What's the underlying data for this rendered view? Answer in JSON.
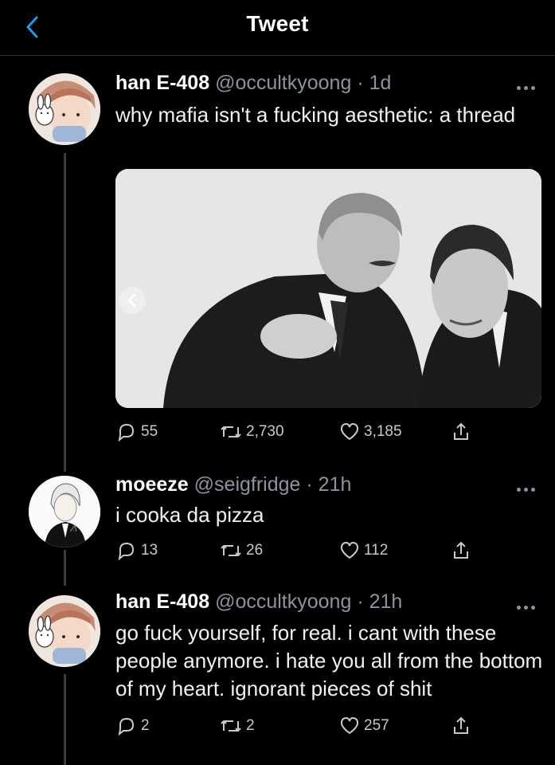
{
  "header": {
    "title": "Tweet",
    "back_icon": "chevron-left-icon",
    "accent": "#1d9bf0"
  },
  "tweets": [
    {
      "name": "han E-408",
      "handle": "@occultkyoong",
      "time": "· 1d",
      "text": "why mafia isn't a fucking aesthetic: a thread",
      "replies": "55",
      "retweets": "2,730",
      "likes": "3,185"
    },
    {
      "name": "moeeze",
      "handle": "@seigfridge",
      "time": "· 21h",
      "text": "i cooka da pizza",
      "replies": "13",
      "retweets": "26",
      "likes": "112"
    },
    {
      "name": "han E-408",
      "handle": "@occultkyoong",
      "time": "· 21h",
      "text": "go fuck yourself, for real. i cant with these people anymore. i hate you all from the bottom of my heart. ignorant pieces of shit",
      "replies": "2",
      "retweets": "2",
      "likes": "257"
    }
  ],
  "icons": {
    "reply": "reply-icon",
    "retweet": "retweet-icon",
    "like": "heart-icon",
    "share": "share-icon",
    "more": "more-icon"
  }
}
